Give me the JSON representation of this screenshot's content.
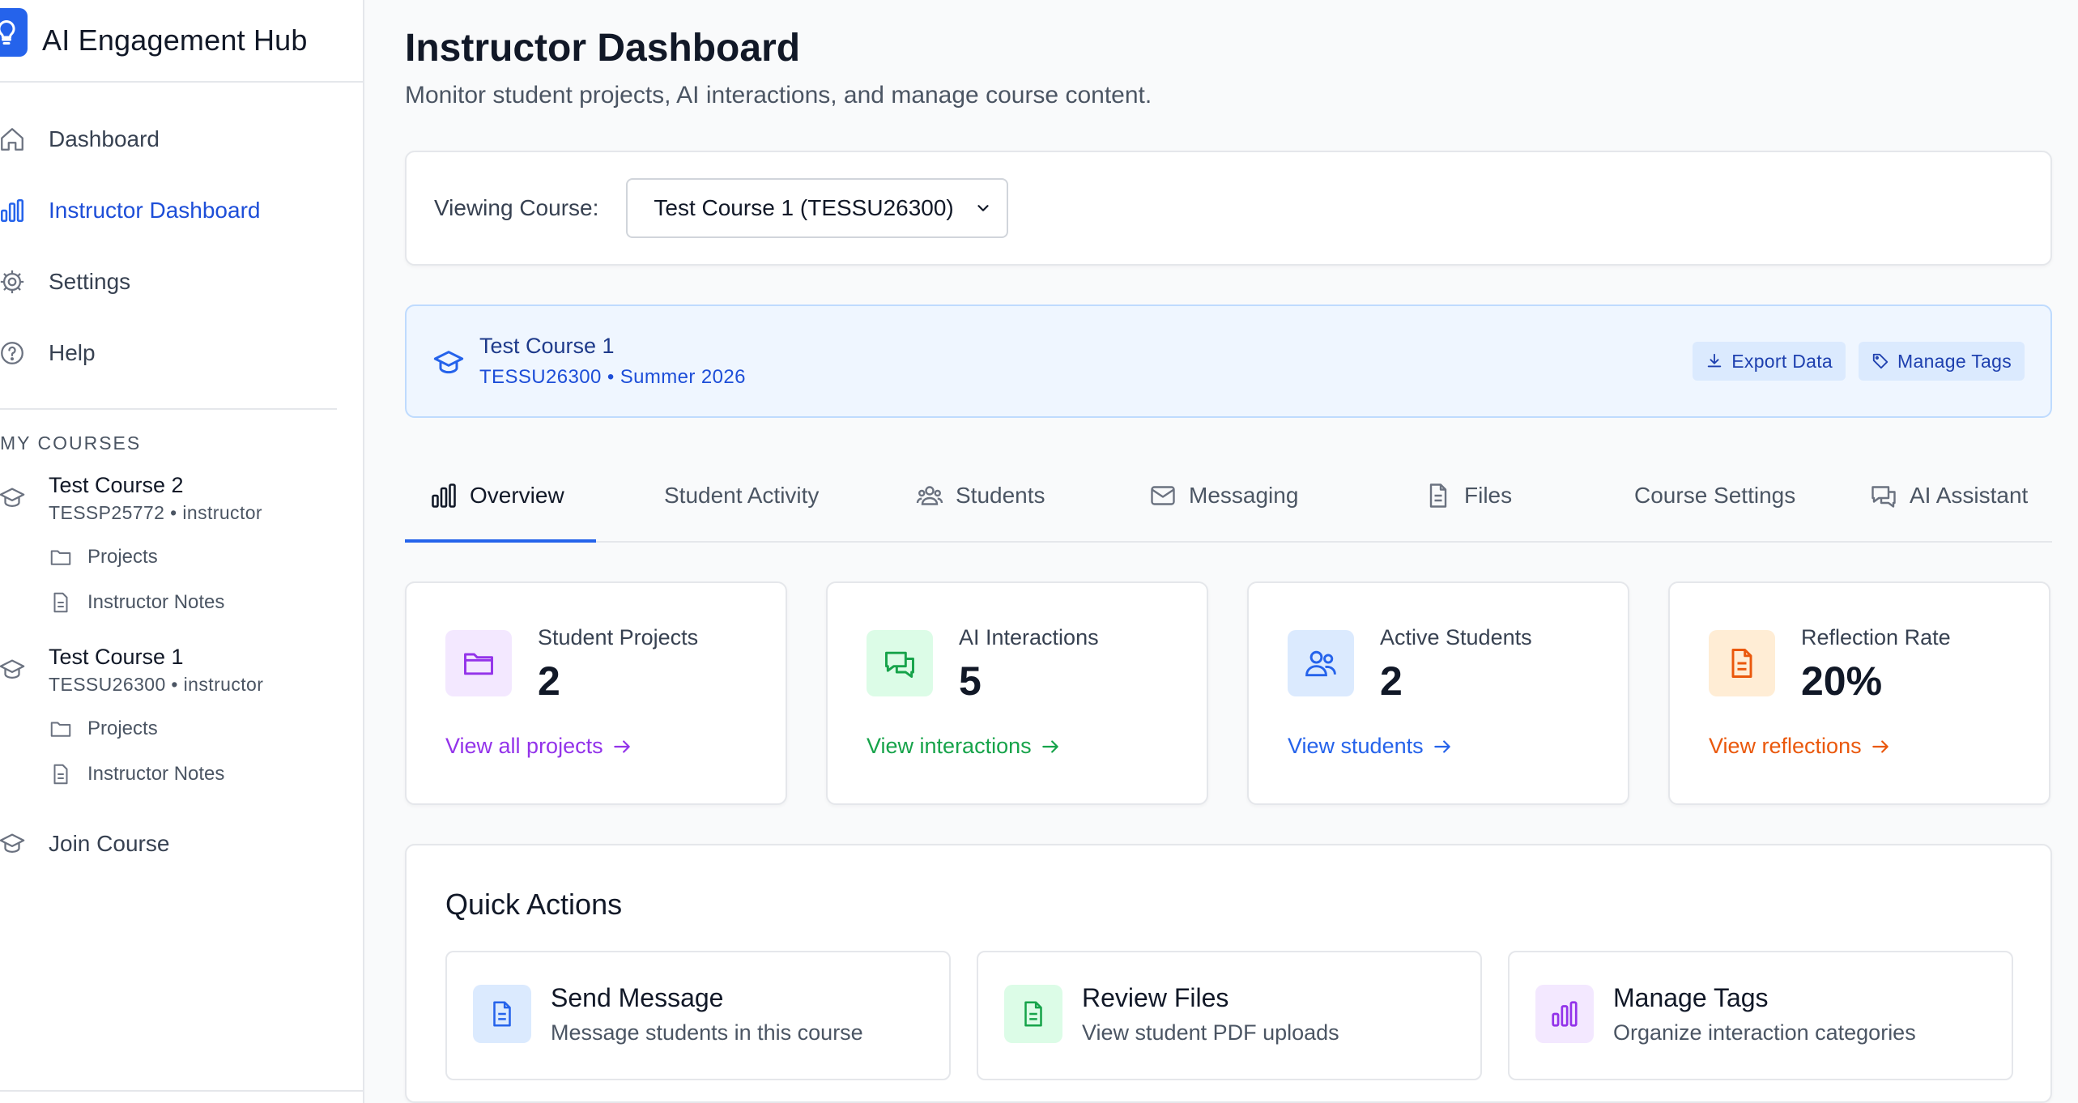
{
  "app": {
    "title": "AI Engagement Hub"
  },
  "nav": {
    "items": [
      {
        "label": "Dashboard",
        "icon": "home-icon",
        "active": false
      },
      {
        "label": "Instructor Dashboard",
        "icon": "bar-chart-icon",
        "active": true
      },
      {
        "label": "Settings",
        "icon": "gear-icon",
        "active": false
      },
      {
        "label": "Help",
        "icon": "help-circle-icon",
        "active": false
      }
    ]
  },
  "my_courses": {
    "title": "MY COURSES",
    "courses": [
      {
        "name": "Test Course 2",
        "meta": "TESSP25772 • instructor",
        "links": [
          {
            "label": "Projects",
            "icon": "folder-icon"
          },
          {
            "label": "Instructor Notes",
            "icon": "document-icon"
          }
        ]
      },
      {
        "name": "Test Course 1",
        "meta": "TESSU26300 • instructor",
        "links": [
          {
            "label": "Projects",
            "icon": "folder-icon"
          },
          {
            "label": "Instructor Notes",
            "icon": "document-icon"
          }
        ]
      }
    ],
    "join_label": "Join Course"
  },
  "page": {
    "title": "Instructor Dashboard",
    "subtitle": "Monitor student projects, AI interactions, and manage course content."
  },
  "course_select": {
    "label": "Viewing Course:",
    "selected": "Test Course 1 (TESSU26300)"
  },
  "banner": {
    "title": "Test Course 1",
    "meta": "TESSU26300 • Summer 2026",
    "export_label": "Export Data",
    "tags_label": "Manage Tags"
  },
  "tabs": [
    {
      "label": "Overview",
      "icon": "bar-chart-icon",
      "active": true
    },
    {
      "label": "Student Activity",
      "icon": "",
      "active": false
    },
    {
      "label": "Students",
      "icon": "users-icon",
      "active": false
    },
    {
      "label": "Messaging",
      "icon": "mail-icon",
      "active": false
    },
    {
      "label": "Files",
      "icon": "file-icon",
      "active": false
    },
    {
      "label": "Course Settings",
      "icon": "",
      "active": false
    },
    {
      "label": "AI Assistant",
      "icon": "chat-icon",
      "active": false
    }
  ],
  "stats": [
    {
      "label": "Student Projects",
      "value": "2",
      "link": "View all projects",
      "color": "#9333ea",
      "bg": "#f3e8ff"
    },
    {
      "label": "AI Interactions",
      "value": "5",
      "link": "View interactions",
      "color": "#16a34a",
      "bg": "#dcfce7"
    },
    {
      "label": "Active Students",
      "value": "2",
      "link": "View students",
      "color": "#2563eb",
      "bg": "#dbeafe"
    },
    {
      "label": "Reflection Rate",
      "value": "20%",
      "link": "View reflections",
      "color": "#ea580c",
      "bg": "#ffedd5"
    }
  ],
  "quick_actions": {
    "title": "Quick Actions",
    "items": [
      {
        "title": "Send Message",
        "desc": "Message students in this course",
        "color": "#2563eb",
        "bg": "#dbeafe"
      },
      {
        "title": "Review Files",
        "desc": "View student PDF uploads",
        "color": "#16a34a",
        "bg": "#dcfce7"
      },
      {
        "title": "Manage Tags",
        "desc": "Organize interaction categories",
        "color": "#9333ea",
        "bg": "#f3e8ff"
      }
    ]
  }
}
